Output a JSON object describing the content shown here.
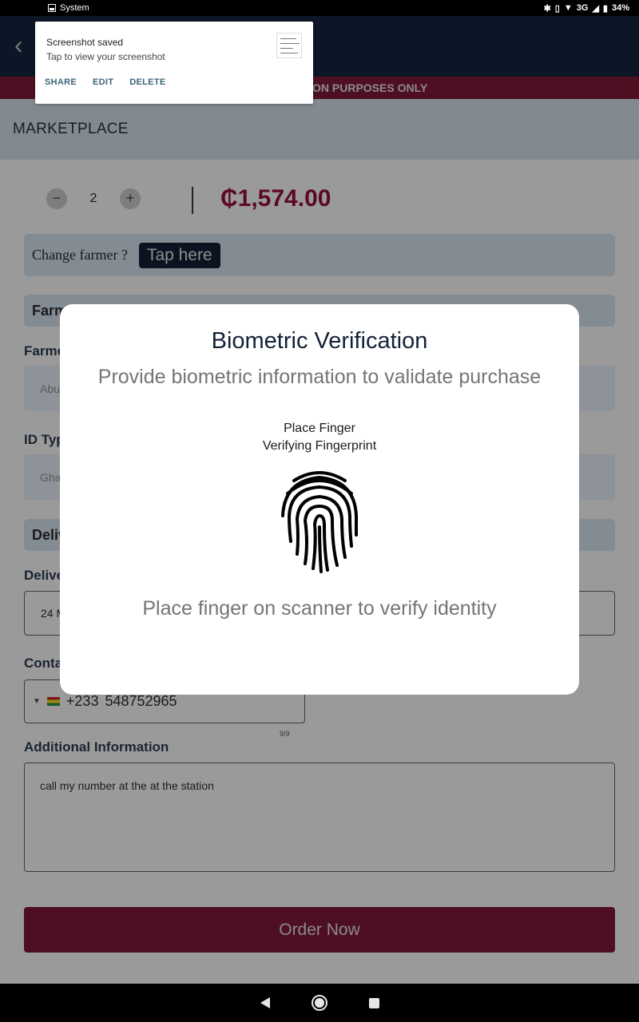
{
  "status_bar": {
    "label": "System",
    "network": "3G",
    "battery": "34%"
  },
  "notification": {
    "title": "Screenshot saved",
    "subtitle": "Tap to view your screenshot",
    "actions": [
      "SHARE",
      "EDIT",
      "DELETE"
    ]
  },
  "banner": {
    "text": "ON PURPOSES ONLY"
  },
  "header": {
    "title": "MARKETPLACE"
  },
  "quantity": {
    "minus": "−",
    "value": "2",
    "plus": "+"
  },
  "price": "₵1,574.00",
  "change_farmer": {
    "label": "Change farmer ?",
    "button": "Tap here"
  },
  "sections": {
    "farmer_section": "Farm",
    "farmer_label": "Farme",
    "farmer_value": "Abu",
    "id_type_label": "ID Typ",
    "id_type_value": "Gha",
    "delivery_section": "Deliv",
    "delivery_label": "Delive",
    "delivery_value": "24 M",
    "contact_label": "Conta"
  },
  "phone": {
    "code": "+233",
    "number": "548752965",
    "counter": "9/9"
  },
  "additional": {
    "label": "Additional Information",
    "value": "call my number at the at the station"
  },
  "order_button": "Order Now",
  "dialog": {
    "title": "Biometric Verification",
    "subtitle": "Provide biometric information to validate purchase",
    "status_line1": "Place Finger",
    "status_line2": "Verifying Fingerprint",
    "hint": "Place finger on scanner to verify identity"
  }
}
